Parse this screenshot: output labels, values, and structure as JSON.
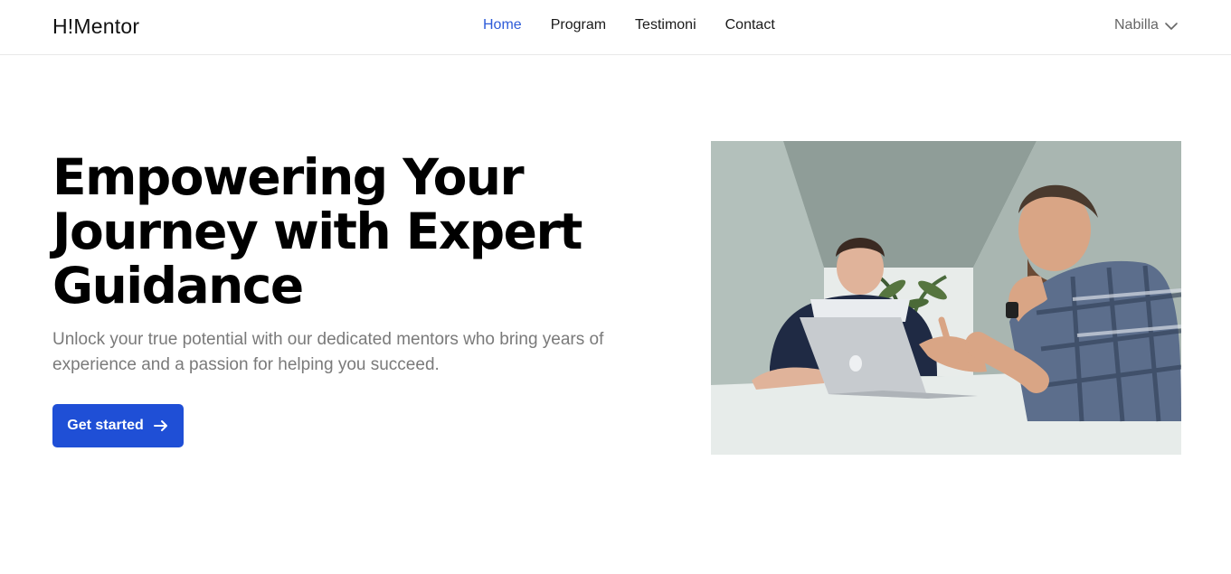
{
  "header": {
    "brand": "H!Mentor",
    "nav": [
      {
        "label": "Home",
        "active": true
      },
      {
        "label": "Program",
        "active": false
      },
      {
        "label": "Testimoni",
        "active": false
      },
      {
        "label": "Contact",
        "active": false
      }
    ],
    "user_name": "Nabilla",
    "user_menu_icon": "chevron-down-icon"
  },
  "hero": {
    "title": "Empowering Your Journey with Expert Guidance",
    "subtitle": "Unlock your true potential with our dedicated mentors who bring years of experience and a passion for helping you succeed.",
    "cta_label": "Get started",
    "cta_icon": "arrow-right-icon"
  },
  "colors": {
    "accent": "#1f4fd6",
    "nav_active": "#2d5bd8",
    "subtitle_text": "#7a7a7a"
  }
}
